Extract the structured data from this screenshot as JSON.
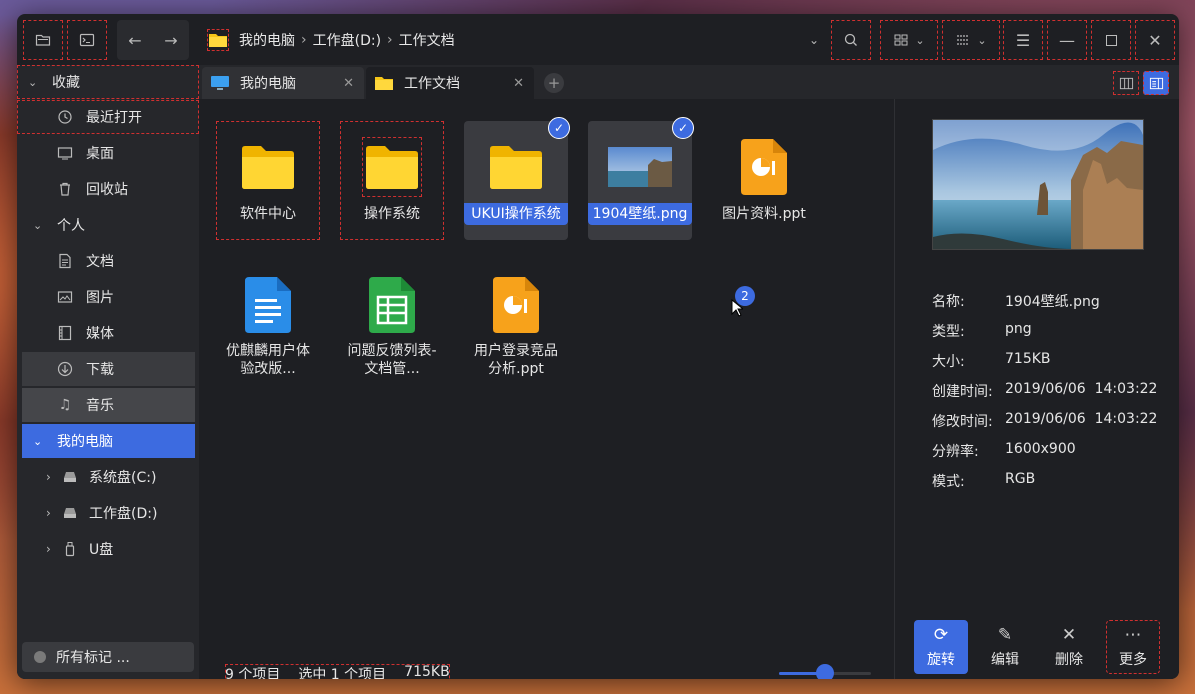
{
  "titlebar": {
    "breadcrumbs": [
      "我的电脑",
      "工作盘(D:)",
      "工作文档"
    ]
  },
  "sidebar": {
    "favorites_label": "收藏",
    "favorites": [
      {
        "label": "最近打开",
        "icon": "clock-icon"
      },
      {
        "label": "桌面",
        "icon": "desktop-icon"
      },
      {
        "label": "回收站",
        "icon": "trash-icon"
      }
    ],
    "personal_label": "个人",
    "personal": [
      {
        "label": "文档",
        "icon": "document-icon"
      },
      {
        "label": "图片",
        "icon": "image-icon"
      },
      {
        "label": "媒体",
        "icon": "film-icon"
      },
      {
        "label": "下载",
        "icon": "download-icon"
      },
      {
        "label": "音乐",
        "icon": "music-icon"
      }
    ],
    "computer_label": "我的电脑",
    "disks": [
      {
        "label": "系统盘(C:)",
        "icon": "disk-icon"
      },
      {
        "label": "工作盘(D:)",
        "icon": "disk-icon"
      },
      {
        "label": "U盘",
        "icon": "usb-icon"
      }
    ],
    "tags_label": "所有标记 ..."
  },
  "tabs": [
    {
      "label": "我的电脑",
      "active": false
    },
    {
      "label": "工作文档",
      "active": true
    }
  ],
  "files": [
    {
      "name": "软件中心",
      "type": "folder",
      "selected": false
    },
    {
      "name": "操作系统",
      "type": "folder",
      "selected": false
    },
    {
      "name": "UKUI操作系统",
      "type": "folder",
      "selected": true
    },
    {
      "name": "1904壁纸.png",
      "type": "image",
      "selected": true
    },
    {
      "name": "图片资料.ppt",
      "type": "ppt",
      "selected": false
    },
    {
      "name": "优麒麟用户体验改版...",
      "type": "doc",
      "selected": false
    },
    {
      "name": "问题反馈列表-文档管...",
      "type": "sheet",
      "selected": false
    },
    {
      "name": "用户登录竞品分析.ppt",
      "type": "ppt",
      "selected": false
    }
  ],
  "drag_badge": "2",
  "status": {
    "count": "9 个项目",
    "selected": "选中 1 个项目",
    "size": "715KB"
  },
  "zoom_level": 0.5,
  "preview": {
    "props": [
      {
        "key": "名称:",
        "value": "1904壁纸.png"
      },
      {
        "key": "类型:",
        "value": "png"
      },
      {
        "key": "大小:",
        "value": "715KB"
      },
      {
        "key": "创建时间:",
        "value": "2019/06/06  14:03:22"
      },
      {
        "key": "修改时间:",
        "value": "2019/06/06  14:03:22"
      },
      {
        "key": "分辨率:",
        "value": "1600x900"
      },
      {
        "key": "模式:",
        "value": "RGB"
      }
    ],
    "actions": [
      {
        "label": "旋转",
        "icon": "rotate-icon"
      },
      {
        "label": "编辑",
        "icon": "edit-icon"
      },
      {
        "label": "删除",
        "icon": "delete-icon"
      },
      {
        "label": "更多",
        "icon": "more-icon"
      }
    ]
  },
  "colors": {
    "accent": "#3d6be0",
    "window_bg": "#1e1f23",
    "sidebar_bg": "#26272b"
  }
}
